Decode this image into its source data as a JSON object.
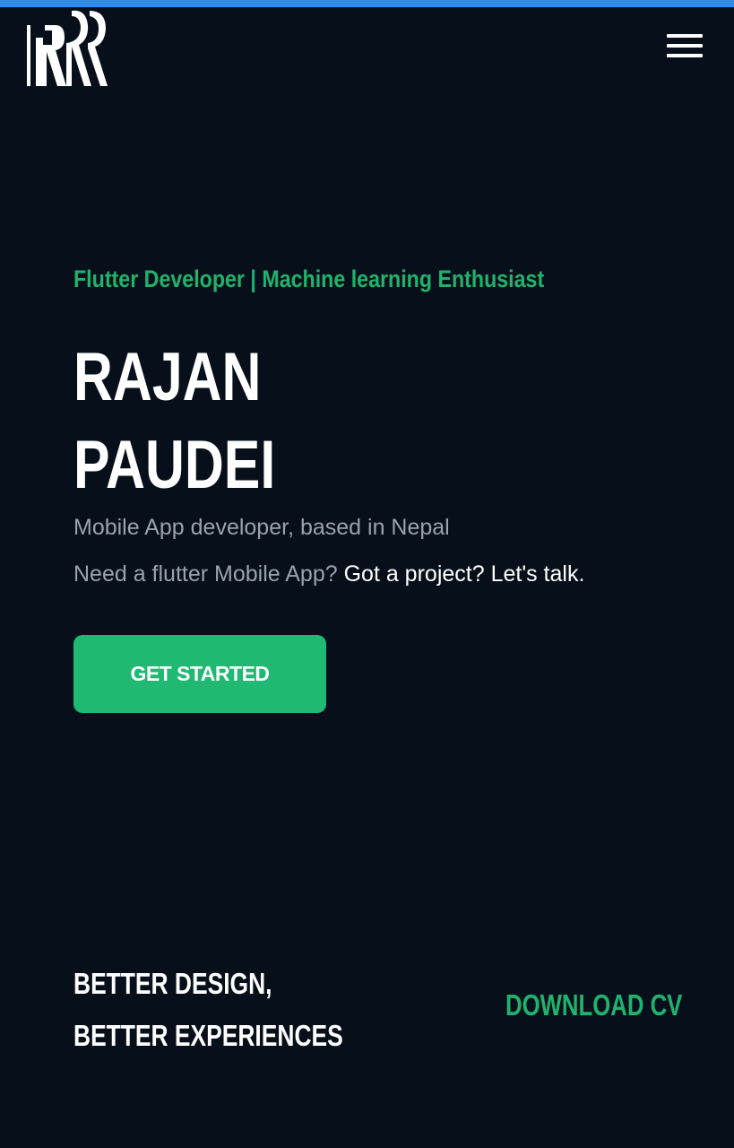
{
  "header": {
    "logo_text": "RR",
    "menu_icon": "hamburger-menu-icon"
  },
  "hero": {
    "tagline": "Flutter Developer | Machine learning Enthusiast",
    "name_line1": "RAJAN",
    "name_line2": "PAUDEI",
    "subtitle": "Mobile App developer, based in Nepal",
    "cta_muted": "Need a flutter Mobile App?",
    "cta_bright": "Got a project? Let's talk.",
    "button_label": "GET STARTED"
  },
  "footer_section": {
    "heading_line1": "BETTER DESIGN,",
    "heading_line2": "BETTER EXPERIENCES",
    "download_label": "DOWNLOAD CV"
  },
  "colors": {
    "background": "#07101a",
    "accent_green": "#1fb974",
    "top_bar_blue": "#2e8de8",
    "muted_text": "#9aa3ad"
  }
}
